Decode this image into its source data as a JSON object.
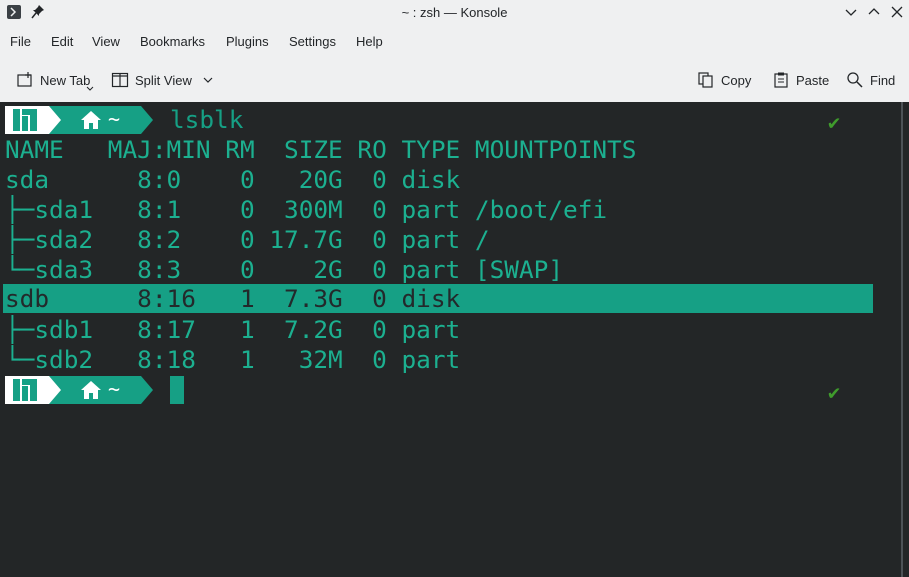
{
  "window": {
    "title": "~ : zsh — Konsole",
    "app_icon": "terminal-icon",
    "pin_icon": "pin-icon",
    "controls": [
      "minimize-icon",
      "maximize-icon",
      "close-icon"
    ]
  },
  "menu": {
    "items": [
      "File",
      "Edit",
      "View",
      "Bookmarks",
      "Plugins",
      "Settings",
      "Help"
    ]
  },
  "toolbar": {
    "new_tab": "New Tab",
    "split_view": "Split View",
    "copy": "Copy",
    "paste": "Paste",
    "find": "Find"
  },
  "terminal": {
    "colors": {
      "background": "#232627",
      "accent": "#16a085",
      "text": "#1cb090",
      "check": "#3f9b2c"
    },
    "prompt": {
      "dir": "~",
      "home_icon": "home-icon",
      "distro_icon": "manjaro-logo-icon"
    },
    "command": "lsblk",
    "status_mark": "✔",
    "header": "NAME   MAJ:MIN RM  SIZE RO TYPE MOUNTPOINTS",
    "rows": [
      "sda      8:0    0   20G  0 disk",
      "├─sda1   8:1    0  300M  0 part /boot/efi",
      "├─sda2   8:2    0 17.7G  0 part /",
      "└─sda3   8:3    0    2G  0 part [SWAP]",
      "sdb      8:16   1  7.3G  0 disk",
      "├─sdb1   8:17   1  7.2G  0 part",
      "└─sdb2   8:18   1   32M  0 part"
    ],
    "selected_row": 4
  }
}
